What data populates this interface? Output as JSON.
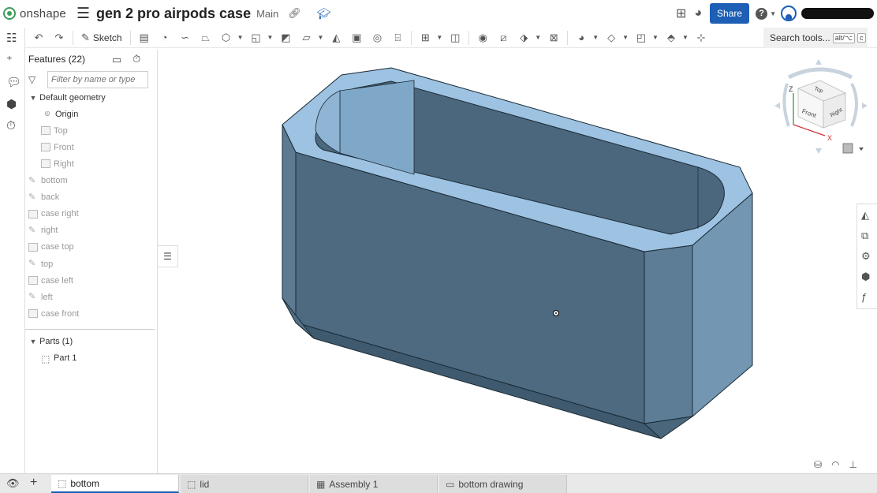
{
  "header": {
    "logo": "onshape",
    "doc_title": "gen 2 pro airpods case",
    "branch": "Main",
    "share_label": "Share"
  },
  "toolbar": {
    "sketch_label": "Sketch",
    "search_label": "Search tools...",
    "search_shortcut_1": "alt/⌥",
    "search_shortcut_2": "c"
  },
  "features_panel": {
    "title": "Features (22)",
    "filter_placeholder": "Filter by name or type",
    "default_geometry_label": "Default geometry",
    "default_geometry": [
      {
        "label": "Origin",
        "icon": "origin-icon"
      },
      {
        "label": "Top",
        "icon": "plane-icon"
      },
      {
        "label": "Front",
        "icon": "plane-icon"
      },
      {
        "label": "Right",
        "icon": "plane-icon"
      }
    ],
    "features": [
      {
        "label": "bottom",
        "icon": "sketch-icon"
      },
      {
        "label": "back",
        "icon": "sketch-icon"
      },
      {
        "label": "case right",
        "icon": "plane-icon"
      },
      {
        "label": "right",
        "icon": "sketch-icon"
      },
      {
        "label": "case top",
        "icon": "plane-icon"
      },
      {
        "label": "top",
        "icon": "sketch-icon"
      },
      {
        "label": "case left",
        "icon": "plane-icon"
      },
      {
        "label": "left",
        "icon": "sketch-icon"
      },
      {
        "label": "case front",
        "icon": "plane-icon"
      }
    ],
    "parts_label": "Parts (1)",
    "parts": [
      {
        "label": "Part 1",
        "icon": "part-icon"
      }
    ]
  },
  "view_cube": {
    "faces": [
      "Top",
      "Front",
      "Right"
    ],
    "axes": [
      "Z",
      "X"
    ]
  },
  "tabs": [
    {
      "label": "bottom",
      "icon": "part-studio-icon",
      "active": true
    },
    {
      "label": "lid",
      "icon": "part-studio-icon",
      "active": false
    },
    {
      "label": "Assembly 1",
      "icon": "assembly-icon",
      "active": false
    },
    {
      "label": "bottom drawing",
      "icon": "drawing-icon",
      "active": false
    }
  ],
  "colors": {
    "accent": "#1c5fb5",
    "model_top": "#9ec4e4",
    "model_side": "#4f6e84",
    "model_front": "#4a6a80",
    "model_end": "#6f93ad"
  }
}
